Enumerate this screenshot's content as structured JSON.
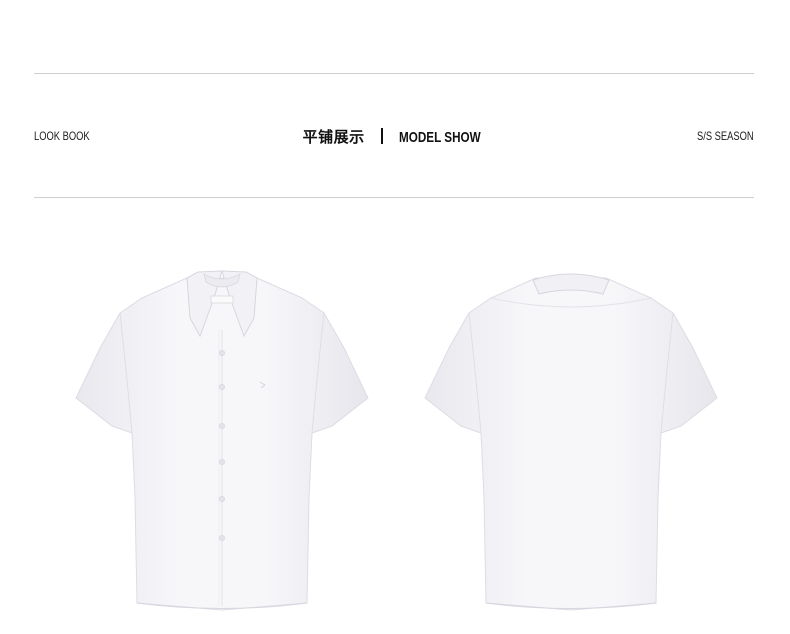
{
  "header": {
    "left_label": "LOOK BOOK",
    "title_cn": "平铺展示",
    "title_en": "MODEL SHOW",
    "right_label": "S/S SEASON"
  },
  "products": {
    "front_view": {
      "icon": "shirt-front-image"
    },
    "back_view": {
      "icon": "shirt-back-image"
    }
  }
}
